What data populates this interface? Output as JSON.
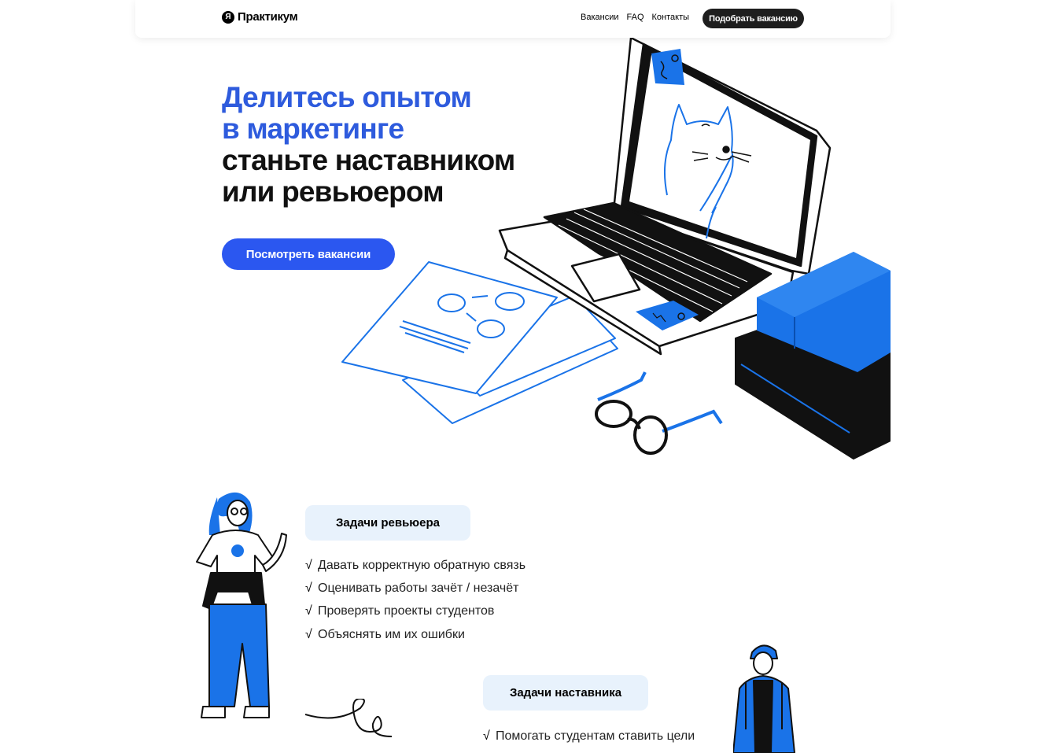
{
  "header": {
    "logo_mark": "Я",
    "logo_text": "Практикум",
    "nav": [
      "Вакансии",
      "FAQ",
      "Контакты"
    ],
    "cta_label": "Подобрать вакансию"
  },
  "hero": {
    "title_blue_1": "Делитесь опытом",
    "title_blue_2": "в маркетинге",
    "title_black_1": "станьте наставником",
    "title_black_2": "или ревьюером",
    "button_label": "Посмотреть вакансии"
  },
  "reviewer": {
    "title": "Задачи ревьюера",
    "check": "√",
    "tasks": [
      "Давать корректную обратную связь",
      "Оценивать работы зачёт / незачёт",
      "Проверять проекты студентов",
      "Объяснять им их ошибки"
    ]
  },
  "mentor": {
    "title": "Задачи наставника",
    "check": "√",
    "tasks": [
      "Помогать студентам ставить цели"
    ]
  },
  "colors": {
    "accent_blue": "#2b57f0",
    "title_blue": "#2e5bdd",
    "illustration_blue": "#1a73e8",
    "pill_bg": "#e8f2fc"
  }
}
